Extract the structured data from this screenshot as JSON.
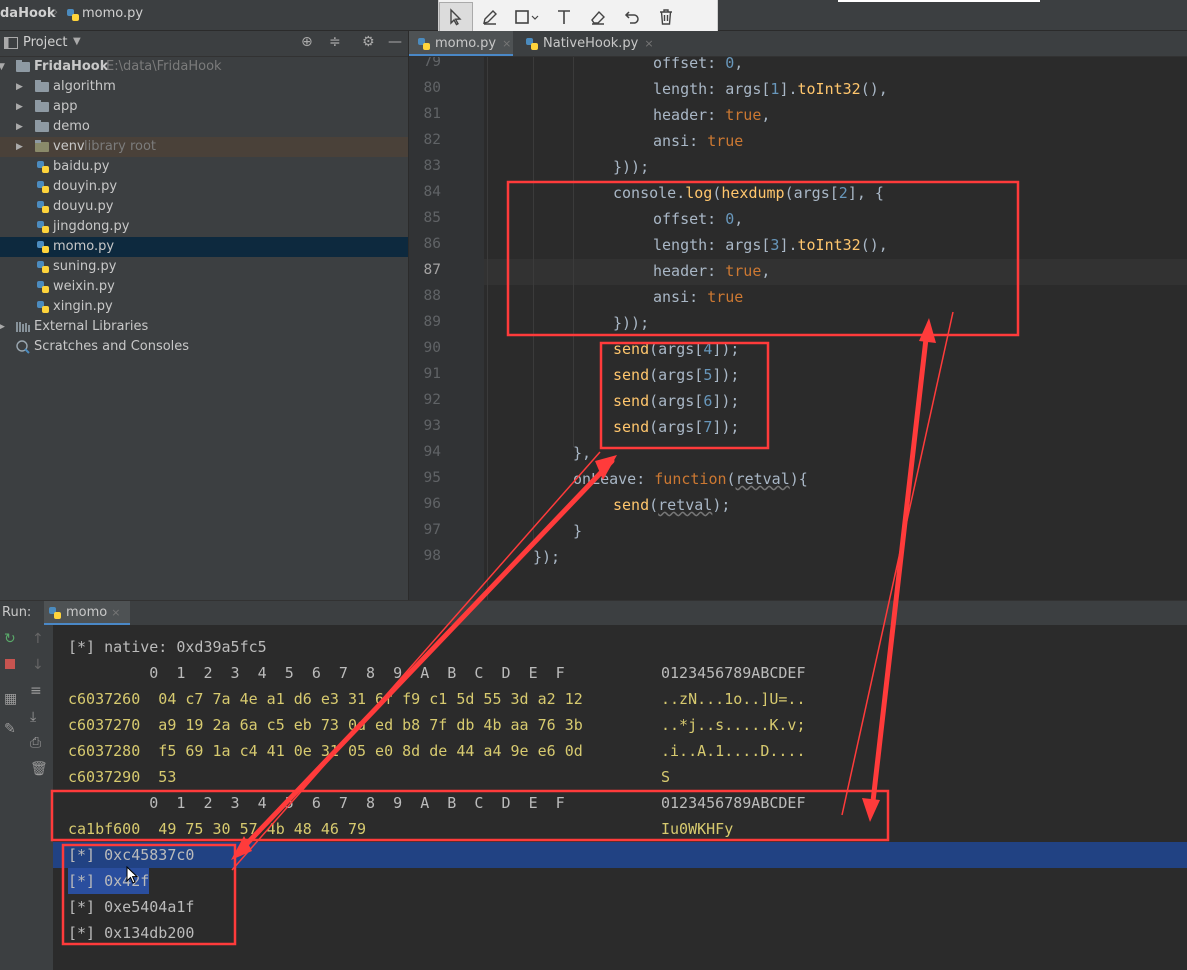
{
  "breadcrumb": {
    "project": "daHook",
    "file": "momo.py"
  },
  "project_panel": {
    "title": "Project",
    "tree": [
      {
        "name": "FridaHook",
        "note": "E:\\data\\FridaHook",
        "kind": "root"
      },
      {
        "name": "algorithm",
        "kind": "folder"
      },
      {
        "name": "app",
        "kind": "folder"
      },
      {
        "name": "demo",
        "kind": "folder"
      },
      {
        "name": "venv",
        "note": "library root",
        "kind": "folder"
      },
      {
        "name": "baidu.py",
        "kind": "file"
      },
      {
        "name": "douyin.py",
        "kind": "file"
      },
      {
        "name": "douyu.py",
        "kind": "file"
      },
      {
        "name": "jingdong.py",
        "kind": "file"
      },
      {
        "name": "momo.py",
        "kind": "file"
      },
      {
        "name": "suning.py",
        "kind": "file"
      },
      {
        "name": "weixin.py",
        "kind": "file"
      },
      {
        "name": "xingin.py",
        "kind": "file"
      },
      {
        "name": "External Libraries",
        "kind": "lib"
      },
      {
        "name": "Scratches and Consoles",
        "kind": "scratch"
      }
    ]
  },
  "editor_tabs": [
    {
      "label": "momo.py",
      "close": "×"
    },
    {
      "label": "NativeHook.py",
      "close": "×"
    }
  ],
  "editor": {
    "current_line": "87",
    "lines": [
      {
        "num": "79",
        "text": "offset: 0,"
      },
      {
        "num": "80",
        "text": "length: args[1].toInt32(),"
      },
      {
        "num": "81",
        "text": "header: true,"
      },
      {
        "num": "82",
        "text": "ansi: true"
      },
      {
        "num": "83",
        "text": "}));"
      },
      {
        "num": "84",
        "text": "console.log(hexdump(args[2], {"
      },
      {
        "num": "85",
        "text": "offset: 0,"
      },
      {
        "num": "86",
        "text": "length: args[3].toInt32(),"
      },
      {
        "num": "87",
        "text": "header: true,"
      },
      {
        "num": "88",
        "text": "ansi: true"
      },
      {
        "num": "89",
        "text": "}));"
      },
      {
        "num": "90",
        "text": "send(args[4]);"
      },
      {
        "num": "91",
        "text": "send(args[5]);"
      },
      {
        "num": "92",
        "text": "send(args[6]);"
      },
      {
        "num": "93",
        "text": "send(args[7]);"
      },
      {
        "num": "94",
        "text": "},"
      },
      {
        "num": "95",
        "text": "onLeave: function(retval){"
      },
      {
        "num": "96",
        "text": "send(retval);"
      },
      {
        "num": "97",
        "text": "}"
      },
      {
        "num": "98",
        "text": "});"
      }
    ]
  },
  "run_panel": {
    "label": "Run:",
    "tab": "momo",
    "close": "×",
    "console": [
      {
        "text": "[*] native: 0xd39a5fc5"
      },
      {
        "hex": "         0  1  2  3  4  5  6  7  8  9  A  B  C  D  E  F",
        "ascii": "0123456789ABCDEF"
      },
      {
        "hex": "c6037260  04 c7 7a 4e a1 d6 e3 31 6f f9 c1 5d 55 3d a2 12",
        "ascii": "..zN...1o..]U=.."
      },
      {
        "hex": "c6037270  a9 19 2a 6a c5 eb 73 0d ed b8 7f db 4b aa 76 3b",
        "ascii": "..*j..s.....K.v;"
      },
      {
        "hex": "c6037280  f5 69 1a c4 41 0e 31 05 e0 8d de 44 a4 9e e6 0d",
        "ascii": ".i..A.1....D...."
      },
      {
        "hex": "c6037290  53",
        "ascii": "S"
      },
      {
        "hex": "         0  1  2  3  4  5  6  7  8  9  A  B  C  D  E  F",
        "ascii": "0123456789ABCDEF"
      },
      {
        "hex": "ca1bf600  49 75 30 57 4b 48 46 79",
        "ascii": "Iu0WKHFy"
      },
      {
        "text": "[*] 0xc45837c0"
      },
      {
        "text": "[*] 0x42f"
      },
      {
        "text": "[*] 0xe5404a1f"
      },
      {
        "text": "[*] 0x134db200"
      }
    ]
  },
  "colors": {
    "annotation": "#ff3b3b",
    "selection": "#214283",
    "keyword": "#cc7832",
    "number": "#6897bb",
    "function": "#ffc66d"
  }
}
